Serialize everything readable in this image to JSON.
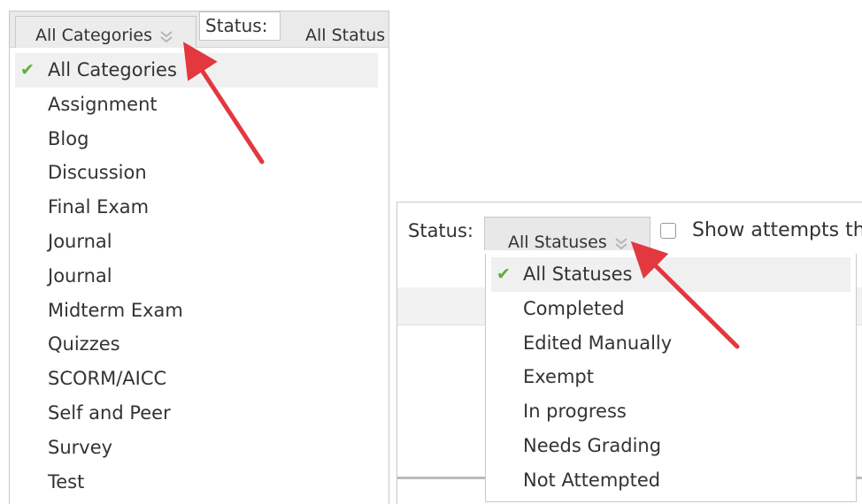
{
  "left": {
    "category_button": "All Categories",
    "status_label": "Status:",
    "status_button": "All Status",
    "category_items": [
      {
        "label": "All Categories",
        "selected": true
      },
      {
        "label": "Assignment"
      },
      {
        "label": "Blog"
      },
      {
        "label": "Discussion"
      },
      {
        "label": "Final Exam"
      },
      {
        "label": "Journal"
      },
      {
        "label": "Journal"
      },
      {
        "label": "Midterm Exam"
      },
      {
        "label": "Quizzes"
      },
      {
        "label": "SCORM/AICC"
      },
      {
        "label": "Self and Peer"
      },
      {
        "label": "Survey"
      },
      {
        "label": "Test"
      }
    ]
  },
  "right": {
    "status_label": "Status:",
    "status_button": "All Statuses",
    "show_attempts_label": "Show attempts th",
    "status_items": [
      {
        "label": "All Statuses",
        "selected": true
      },
      {
        "label": "Completed"
      },
      {
        "label": "Edited Manually"
      },
      {
        "label": "Exempt"
      },
      {
        "label": "In progress"
      },
      {
        "label": "Needs Grading"
      },
      {
        "label": "Not Attempted"
      }
    ]
  },
  "icons": {
    "check": "check-icon",
    "chevron": "double-chevron-down-icon",
    "arrow": "red-arrow-annotation"
  },
  "colors": {
    "check": "#5dae3a",
    "arrow": "#e2383e"
  }
}
